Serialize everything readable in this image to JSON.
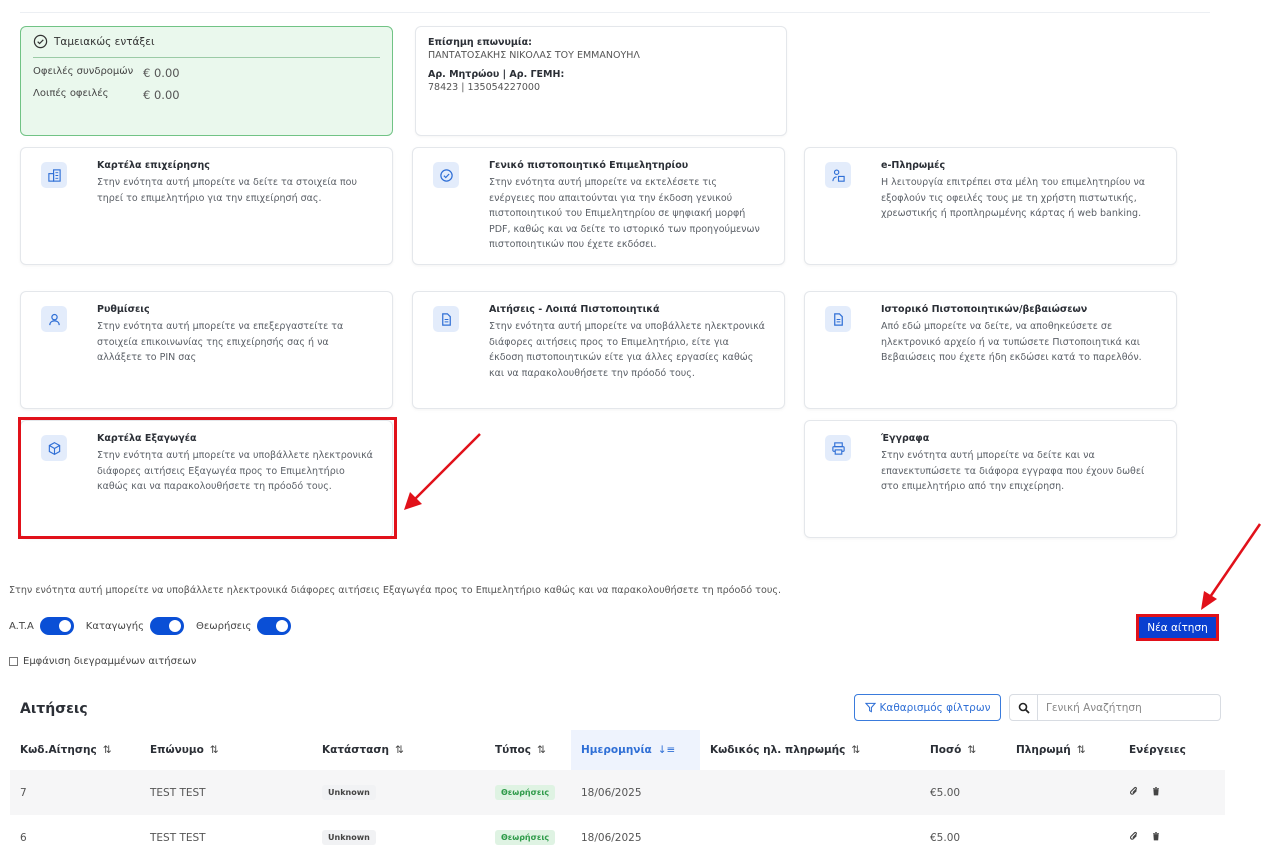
{
  "status": {
    "title": "Ταμειακώς εντάξει",
    "rows": [
      {
        "label": "Οφειλές συνδρομών",
        "value": "€ 0.00"
      },
      {
        "label": "Λοιπές οφειλές",
        "value": "€ 0.00"
      }
    ],
    "accent": "#71c385"
  },
  "company": {
    "name_label": "Επίσημη επωνυμία:",
    "name_value": "ΠΑΝΤΑΤΟΣΑΚΗΣ ΝΙΚΟΛΑΣ ΤΟΥ ΕΜΜΑΝΟΥΗΛ",
    "reg_label": "Αρ. Μητρώου | Αρ. ΓΕΜΗ:",
    "reg_value": "78423 | 135054227000"
  },
  "cards": [
    {
      "icon": "building-icon",
      "title": "Καρτέλα επιχείρησης",
      "desc": "Στην ενότητα αυτή μπορείτε να δείτε τα στοιχεία που τηρεί το επιμελητήριο για την επιχείρησή σας."
    },
    {
      "icon": "check-circle-icon",
      "title": "Γενικό πιστοποιητικό Επιμελητηρίου",
      "desc": "Στην ενότητα αυτή μπορείτε να εκτελέσετε τις ενέργειες που απαιτούνται για την έκδοση γενικού πιστοποιητικού του Επιμελητηρίου σε ψηφιακή μορφή PDF, καθώς και να δείτε το ιστορικό των προηγούμενων πιστοποιητικών που έχετε εκδόσει."
    },
    {
      "icon": "payment-icon",
      "title": "e-Πληρωμές",
      "desc": "Η λειτουργία επιτρέπει στα μέλη του επιμελητηρίου να εξοφλούν τις οφειλές τους με τη χρήστη πιστωτικής, χρεωστικής ή προπληρωμένης κάρτας ή web banking."
    },
    {
      "icon": "user-icon",
      "title": "Ρυθμίσεις",
      "desc": "Στην ενότητα αυτή μπορείτε να επεξεργαστείτε τα στοιχεία επικοινωνίας της επιχείρησής σας ή να αλλάξετε το PIN σας"
    },
    {
      "icon": "document-icon",
      "title": "Αιτήσεις - Λοιπά Πιστοποιητικά",
      "desc": "Στην ενότητα αυτή μπορείτε να υποβάλλετε ηλεκτρονικά διάφορες αιτήσεις προς το Επιμελητήριο, είτε για έκδοση πιστοποιητικών είτε για άλλες εργασίες καθώς και να παρακολουθήσετε την πρόοδό τους."
    },
    {
      "icon": "document-icon",
      "title": "Ιστορικό Πιστοποιητικών/βεβαιώσεων",
      "desc": "Από εδώ μπορείτε να δείτε, να αποθηκεύσετε σε ηλεκτρονικό αρχείο ή να τυπώσετε Πιστοποιητικά και Βεβαιώσεις που έχετε ήδη εκδώσει κατά το παρελθόν."
    },
    {
      "icon": "package-icon",
      "title": "Καρτέλα Εξαγωγέα",
      "desc": "Στην ενότητα αυτή μπορείτε να υποβάλλετε ηλεκτρονικά διάφορες αιτήσεις Εξαγωγέα προς το Επιμελητήριο καθώς και να παρακολουθήσετε τη πρόοδό τους."
    },
    {
      "icon": "printer-icon",
      "title": "Έγγραφα",
      "desc": "Στην ενότητα αυτή μπορείτε να δείτε και να επανεκτυπώσετε τα διάφορα εγγραφα που έχουν δωθεί στο επιμελητήριο από την επιχείρηση."
    }
  ],
  "intro": "Στην ενότητα αυτή μπορείτε να υποβάλλετε ηλεκτρονικά διάφορες αιτήσεις Εξαγωγέα προς το Επιμελητήριο καθώς και να παρακολουθήσετε τη πρόοδό τους.",
  "toggles": [
    {
      "label": "A.T.A",
      "on": true
    },
    {
      "label": "Καταγωγής",
      "on": true
    },
    {
      "label": "Θεωρήσεις",
      "on": true
    }
  ],
  "new_button": "Νέα αίτηση",
  "show_deleted": "Εμφάνιση διεγραμμένων αιτήσεων",
  "table": {
    "title": "Αιτήσεις",
    "clear_filters": "Καθαρισμός φίλτρων",
    "search_placeholder": "Γενική Αναζήτηση",
    "columns": [
      "Κωδ.Αίτησης",
      "Επώνυμο",
      "Κατάσταση",
      "Τύπος",
      "Ημερομηνία",
      "Κωδικός ηλ. πληρωμής",
      "Ποσό",
      "Πληρωμή",
      "Ενέργειες"
    ],
    "sort_icon": "⇅",
    "sort_active_icon": "↓≡",
    "rows": [
      {
        "code": "7",
        "surname": "TEST TEST",
        "status": "Unknown",
        "type": "Θεωρήσεις",
        "date": "18/06/2025",
        "payment_code": "",
        "amount": "€5.00",
        "payment": ""
      },
      {
        "code": "6",
        "surname": "TEST TEST",
        "status": "Unknown",
        "type": "Θεωρήσεις",
        "date": "18/06/2025",
        "payment_code": "",
        "amount": "€5.00",
        "payment": ""
      }
    ]
  },
  "colors": {
    "primary": "#0a3fd0",
    "highlight": "#e1111a",
    "success": "#2f9b4a"
  }
}
